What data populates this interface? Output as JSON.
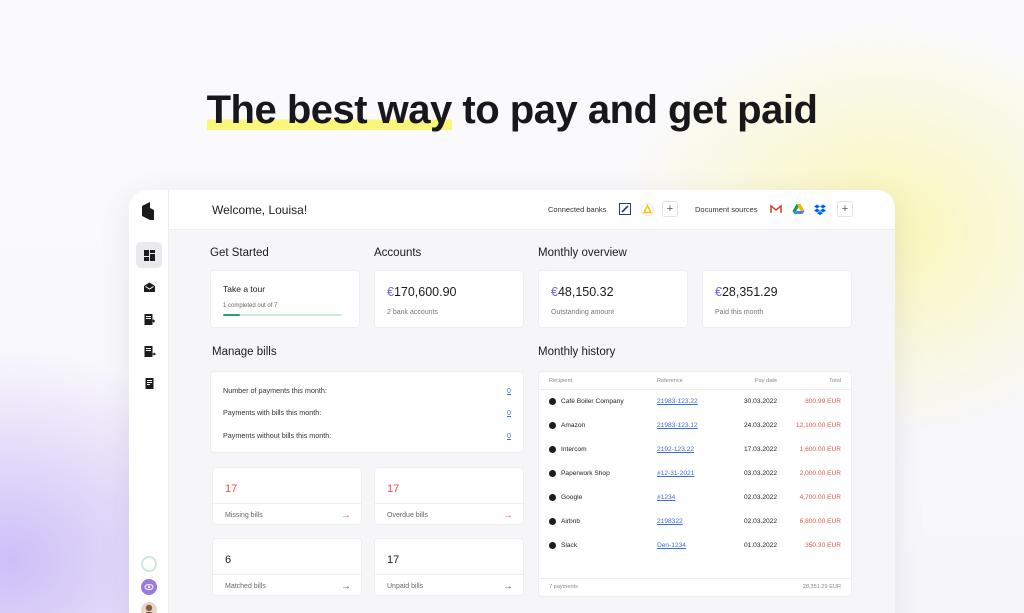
{
  "hero": {
    "highlighted": "The best way",
    "rest": " to pay and get paid"
  },
  "topbar": {
    "welcome": "Welcome, Louisa!",
    "connected_banks_label": "Connected banks",
    "document_sources_label": "Document sources",
    "add_symbol": "+"
  },
  "get_started": {
    "title": "Get Started",
    "tour_title": "Take a tour",
    "tour_progress_text": "1 completed out of 7",
    "tour_progress_fraction": 0.14
  },
  "accounts": {
    "title": "Accounts",
    "currency": "€",
    "amount": "170,600.90",
    "sub": "2 bank accounts"
  },
  "monthly_overview": {
    "title": "Monthly overview",
    "outstanding": {
      "currency": "€",
      "amount": "48,150.32",
      "label": "Outstanding amount"
    },
    "paid": {
      "currency": "€",
      "amount": "28,351.29",
      "label": "Paid this month"
    }
  },
  "manage_bills": {
    "title": "Manage bills",
    "rows": [
      {
        "label": "Number of payments this month:",
        "value": "0"
      },
      {
        "label": "Payments with bills this month:",
        "value": "0"
      },
      {
        "label": "Payments without bills this month:",
        "value": "0"
      }
    ],
    "stats": [
      {
        "value": "17",
        "label": "Missing bills",
        "arrow": "→"
      },
      {
        "value": "17",
        "label": "Overdue bills",
        "arrow": "→"
      },
      {
        "value": "6",
        "label": "Matched bills",
        "arrow": "→"
      },
      {
        "value": "17",
        "label": "Unpaid bills",
        "arrow": "→"
      }
    ]
  },
  "monthly_history": {
    "title": "Monthly history",
    "headers": {
      "recipient": "Recipient",
      "reference": "Reference",
      "pay_date": "Pay date",
      "total": "Total"
    },
    "rows": [
      {
        "recipient": "Café Boiler Company",
        "reference": "21983-123.22",
        "date": "30.03.2022",
        "total": "800.99 EUR"
      },
      {
        "recipient": "Amazon",
        "reference": "21983-123.12",
        "date": "24.03.2022",
        "total": "12,100.00 EUR"
      },
      {
        "recipient": "Intercom",
        "reference": "2192-123.22",
        "date": "17.03.2022",
        "total": "1,600.00 EUR"
      },
      {
        "recipient": "Paperwork Shop",
        "reference": "#12-31-2021",
        "date": "03.03.2022",
        "total": "2,000.00 EUR"
      },
      {
        "recipient": "Google",
        "reference": "#1234",
        "date": "02.03.2022",
        "total": "4,700.00 EUR"
      },
      {
        "recipient": "Airbnb",
        "reference": "2198322",
        "date": "02.03.2022",
        "total": "6,800.00 EUR"
      },
      {
        "recipient": "Slack",
        "reference": "Den-1234",
        "date": "01.03.2022",
        "total": "350.30 EUR"
      }
    ],
    "footer_count": "7 payments",
    "footer_total": "28,351.29 EUR"
  },
  "colors": {
    "accent": "#7b5ad6",
    "negative": "#e0574a",
    "link": "#3a6fd8",
    "progress": "#2aa36b",
    "highlight": "#fbf67a"
  },
  "icons": {
    "logo": "brand-logo-icon",
    "nav": [
      "dashboard-icon",
      "inbox-icon",
      "bill-add-icon",
      "bill-pay-icon",
      "document-icon"
    ],
    "banks": [
      "deutsche-bank-icon",
      "sparkasse-icon"
    ],
    "sources": [
      "gmail-icon",
      "google-drive-icon",
      "dropbox-icon"
    ]
  }
}
